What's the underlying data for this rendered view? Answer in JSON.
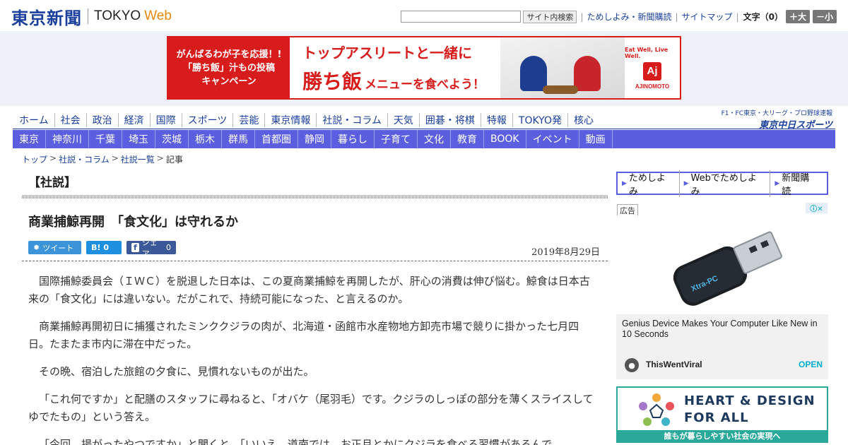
{
  "header": {
    "logo_jp": "東京新聞",
    "logo_en": "TOKYO",
    "logo_web": "Web",
    "search": {
      "placeholder": "",
      "button_label": "サイト内検索"
    },
    "links": [
      "ためしよみ・新聞購読",
      "サイトマップ"
    ],
    "font_size": {
      "label": "文字（0）",
      "larger": "＋大",
      "smaller": "－小"
    }
  },
  "banner": {
    "left_lines": [
      "がんばるわが子を応援！!",
      "「勝ち飯」汁もの投稿",
      "キャンペーン"
    ],
    "headline": "トップアスリートと一緒に",
    "kachimeshi": "勝ち飯",
    "tagline": "メニューを食べよう！",
    "brand_slogan": "Eat Well, Live Well.",
    "brand_mark": "Aj",
    "brand_name": "AJINOMOTO"
  },
  "nav": {
    "main": [
      "ホーム",
      "社会",
      "政治",
      "経済",
      "国際",
      "スポーツ",
      "芸能",
      "東京情報",
      "社説・コラム",
      "天気",
      "囲碁・将棋",
      "特報",
      "TOKYO発",
      "核心"
    ],
    "sub": [
      "東京",
      "神奈川",
      "千葉",
      "埼玉",
      "茨城",
      "栃木",
      "群馬",
      "首都圏",
      "静岡",
      "暮らし",
      "子育て",
      "文化",
      "教育",
      "BOOK",
      "イベント",
      "動画"
    ],
    "chunichi_sub": "F1・FC東京・大リーグ・プロ野球速報",
    "chunichi_name": "東京中日スポーツ"
  },
  "breadcrumb": {
    "items": [
      "トップ",
      "社説・コラム",
      "社説一覧"
    ],
    "current": "記事",
    "sep": ">"
  },
  "section_title": "【社説】",
  "article": {
    "title": "商業捕鯨再開　「食文化」は守れるか",
    "share": {
      "tweet": "ツイート",
      "hatena_glyph": "B!",
      "hatena_count": "0",
      "fb_glyph": "f",
      "fb_label": "シェア",
      "fb_count": "0"
    },
    "date": "2019年8月29日",
    "paragraphs": [
      "国際捕鯨委員会（ＩＷＣ）を脱退した日本は、この夏商業捕鯨を再開したが、肝心の消費は伸び悩む。鯨食は日本古来の「食文化」には違いない。だがこれで、持続可能になった、と言えるのか。",
      "商業捕鯨再開初日に捕獲されたミンククジラの肉が、北海道・函館市水産物地方卸売市場で競りに掛かった七月四日。たまたま市内に滞在中だった。",
      "その晩、宿泊した旅館の夕食に、見慣れないものが出た。",
      "「これ何ですか」と配膳のスタッフに尋ねると、「オバケ（尾羽毛）です。クジラのしっぽの部分を薄くスライスしてゆでたもの」という答え。",
      "「今回、揚がったやつですか」と聞くと、「いいえ。道南では、お正月とかにクジラを食べる習慣があるんで"
    ]
  },
  "sidebar": {
    "links": [
      "ためしよみ",
      "Webでためしよみ",
      "新聞購読"
    ],
    "ad_label": "広告",
    "ad": {
      "product_text": "Xtra-PC",
      "headline": "Genius Device Makes Your Computer Like New in 10 Seconds",
      "source": "ThisWentViral",
      "cta": "OPEN"
    },
    "heart_design": {
      "title_line1": "HEART & DESIGN",
      "title_line2": "FOR ALL",
      "footer": "誰もが暮らしやすい社会の実現へ"
    }
  },
  "colors": {
    "brand_blue": "#1a3f9c",
    "nav_purple": "#5b5fdf",
    "banner_red": "#d81b1b",
    "accent_teal": "#2aa89a"
  }
}
